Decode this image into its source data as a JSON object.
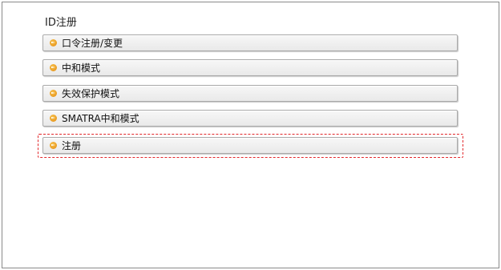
{
  "title": "ID注册",
  "menu": [
    {
      "label": "口令注册/变更"
    },
    {
      "label": "中和模式"
    },
    {
      "label": "失效保护模式"
    },
    {
      "label": "SMATRA中和模式"
    },
    {
      "label": "注册"
    }
  ],
  "colors": {
    "highlight_border": "#e2262a",
    "icon_orange": "#e38b12"
  },
  "icons": {
    "menu_item_icon": "orange-arrow-circle-icon"
  }
}
